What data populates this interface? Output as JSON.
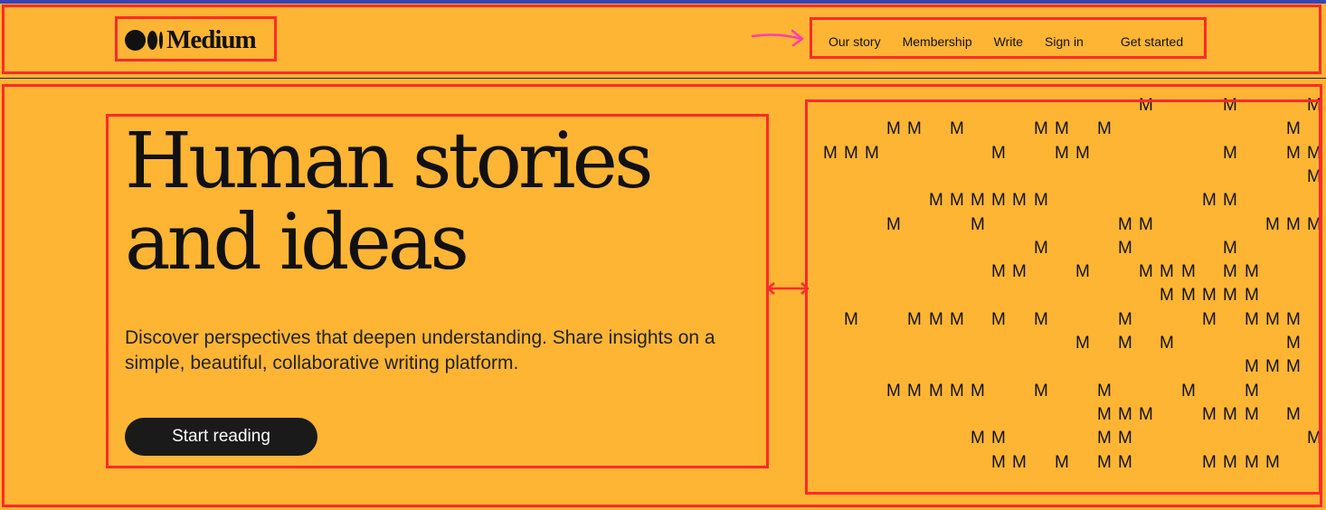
{
  "brand": {
    "name": "Medium"
  },
  "nav": {
    "our_story": "Our story",
    "membership": "Membership",
    "write": "Write",
    "sign_in": "Sign in",
    "get_started": "Get started"
  },
  "hero": {
    "title": "Human stories\nand ideas",
    "subtitle": "Discover perspectives that deepen understanding. Share insights on a simple, beautiful, collaborative writing platform.",
    "cta": "Start reading"
  },
  "art": {
    "glyph": "M",
    "rows": [
      {
        "cols": [
          1267,
          1360,
          1453
        ]
      },
      {
        "cols": [
          988,
          1011,
          1058,
          1151,
          1174,
          1221,
          1430
        ]
      },
      {
        "cols": [
          918,
          941,
          964,
          1104,
          1174,
          1197,
          1360,
          1430,
          1453
        ]
      },
      {
        "cols": [
          1453
        ]
      },
      {
        "cols": [
          1035,
          1058,
          1081,
          1104,
          1127,
          1151,
          1337,
          1360
        ]
      },
      {
        "cols": [
          988,
          1081,
          1244,
          1267,
          1407,
          1430,
          1453
        ]
      },
      {
        "cols": [
          1151,
          1244,
          1360
        ]
      },
      {
        "cols": [
          1104,
          1127,
          1197,
          1267,
          1290,
          1314,
          1360,
          1384
        ]
      },
      {
        "cols": [
          1290,
          1314,
          1337,
          1360,
          1384
        ]
      },
      {
        "cols": [
          941,
          1011,
          1035,
          1058,
          1104,
          1151,
          1244,
          1337,
          1384,
          1407,
          1430
        ]
      },
      {
        "cols": [
          1197,
          1244,
          1290,
          1430
        ]
      },
      {
        "cols": [
          1384,
          1407,
          1430
        ]
      },
      {
        "cols": [
          988,
          1011,
          1035,
          1058,
          1081,
          1151,
          1221,
          1314,
          1384
        ]
      },
      {
        "cols": [
          1221,
          1244,
          1267,
          1337,
          1360,
          1384,
          1430
        ]
      },
      {
        "cols": [
          1081,
          1104,
          1221,
          1244,
          1453
        ]
      },
      {
        "cols": [
          1104,
          1127,
          1174,
          1221,
          1244,
          1337,
          1360,
          1384,
          1407
        ]
      }
    ]
  },
  "colors": {
    "background": "#ffb534",
    "button": "#1a1a1a",
    "annotation": "#ff2a2a",
    "top_bar": "#3a43b3"
  }
}
